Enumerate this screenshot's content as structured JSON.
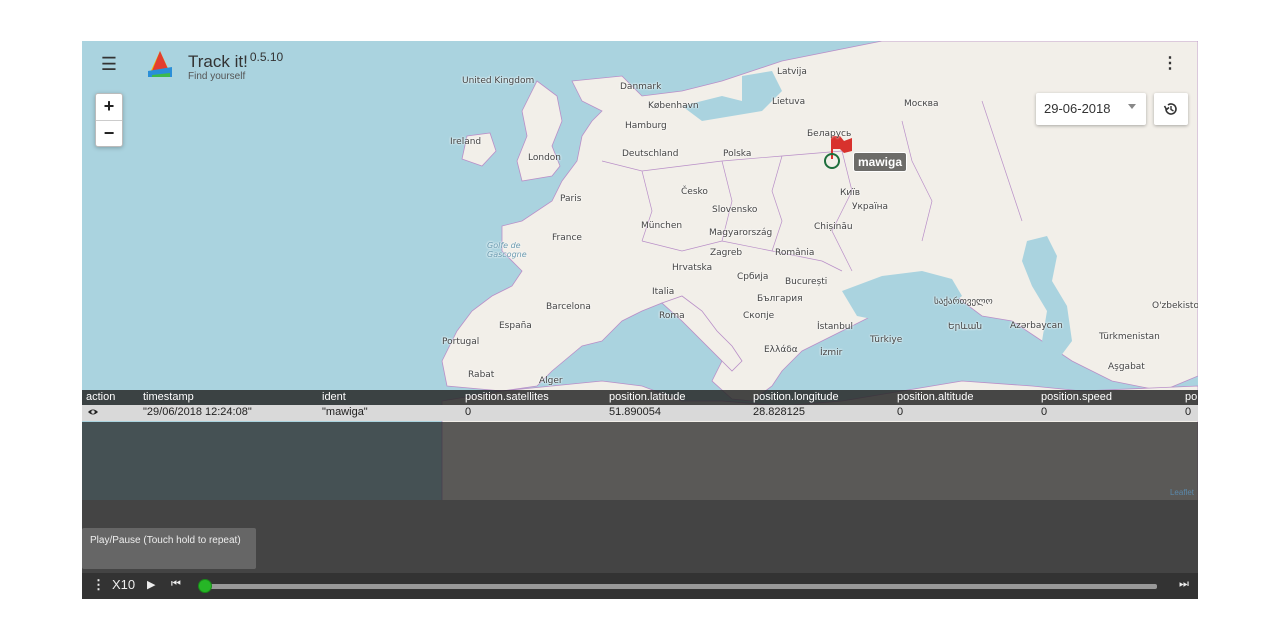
{
  "app": {
    "title": "Track it!",
    "version": "0.5.10",
    "subtitle": "Find yourself"
  },
  "icons": {
    "menu": "menu-icon",
    "more": "more-vert-icon",
    "history": "history-icon",
    "logo": "sail-logo-icon"
  },
  "zoom": {
    "in": "+",
    "out": "−"
  },
  "date_filter": {
    "value": "29-06-2018"
  },
  "marker": {
    "label": "mawiga"
  },
  "map_labels": [
    {
      "text": "United Kingdom"
    },
    {
      "text": "Danmark"
    },
    {
      "text": "København"
    },
    {
      "text": "Latvija"
    },
    {
      "text": "Lietuva"
    },
    {
      "text": "Москва"
    },
    {
      "text": "Ireland"
    },
    {
      "text": "Hamburg"
    },
    {
      "text": "Беларусь"
    },
    {
      "text": "London"
    },
    {
      "text": "Deutschland"
    },
    {
      "text": "Polska"
    },
    {
      "text": "Paris"
    },
    {
      "text": "Česko"
    },
    {
      "text": "Київ"
    },
    {
      "text": "Slovensko"
    },
    {
      "text": "Україна"
    },
    {
      "text": "France"
    },
    {
      "text": "München"
    },
    {
      "text": "Chișinău"
    },
    {
      "text": "Magyarország"
    },
    {
      "text": "Zagreb"
    },
    {
      "text": "România"
    },
    {
      "text": "Hrvatska"
    },
    {
      "text": "Србија"
    },
    {
      "text": "București"
    },
    {
      "text": "Italia"
    },
    {
      "text": "България"
    },
    {
      "text": "Barcelona"
    },
    {
      "text": "Roma"
    },
    {
      "text": "Скопје"
    },
    {
      "text": "España"
    },
    {
      "text": "İstanbul"
    },
    {
      "text": "Portugal"
    },
    {
      "text": "Ελλάδα"
    },
    {
      "text": "İzmir"
    },
    {
      "text": "Türkiye"
    },
    {
      "text": "Azərbaycan"
    },
    {
      "text": "Türkmenistan"
    },
    {
      "text": "Aşgabat"
    },
    {
      "text": "O'zbekiston"
    },
    {
      "text": "Rabat"
    },
    {
      "text": "Alger"
    },
    {
      "text": "Երևան"
    },
    {
      "text": "საქართველო"
    },
    {
      "text": "Golfe de Gascogne"
    }
  ],
  "table": {
    "columns": [
      "action",
      "timestamp",
      "ident",
      "position.satellites",
      "position.latitude",
      "position.longitude",
      "position.altitude",
      "position.speed",
      "po"
    ],
    "rows": [
      [
        "\"29/06/2018 12:24:08\"",
        "\"mawiga\"",
        "0",
        "51.890054",
        "28.828125",
        "0",
        "0",
        "0"
      ]
    ]
  },
  "tooltip": {
    "text": "Play/Pause (Touch hold to repeat)"
  },
  "playback": {
    "speed": "X10",
    "progress": 0
  },
  "attribution": "Leaflet",
  "colors": {
    "sea": "#aad3df",
    "land": "#f2efe9",
    "border": "#b98fc8",
    "marker": "#d8322d",
    "progress": "#26b626"
  }
}
